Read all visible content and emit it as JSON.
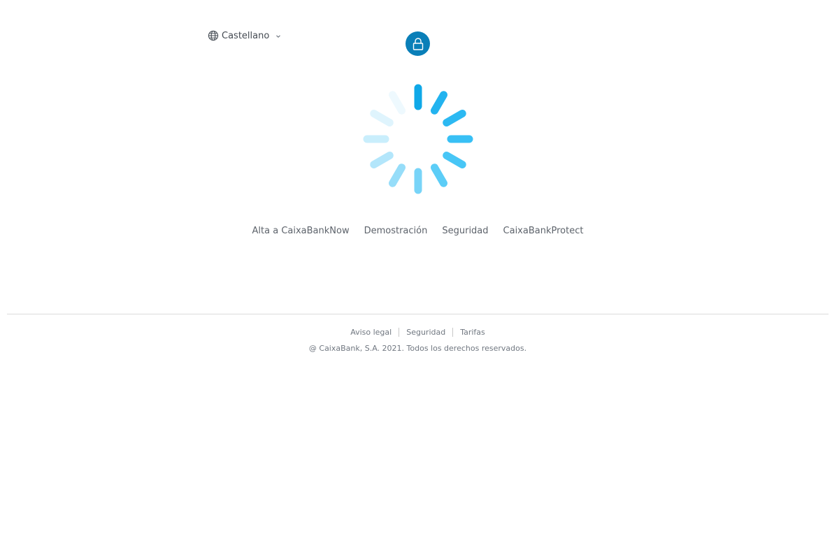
{
  "language": {
    "selected": "Castellano",
    "icon": "globe-icon",
    "chevron_icon": "chevron-down-icon"
  },
  "header": {
    "badge_icon": "lock-icon",
    "badge_color": "#0a7fb8"
  },
  "loader": {
    "icon": "loading-spinner",
    "spoke_colors": [
      "#0fa8e8",
      "#22b3ef",
      "#2cb9f2",
      "#38c0f5",
      "#48c6f6",
      "#5ccdf7",
      "#78d4f8",
      "#96ddf9",
      "#b3e6fb",
      "#c9eefc",
      "#dff4fd",
      "#eef9fe"
    ]
  },
  "links": [
    {
      "label": "Alta a CaixaBankNow"
    },
    {
      "label": "Demostración"
    },
    {
      "label": "Seguridad"
    },
    {
      "label": "CaixaBankProtect"
    }
  ],
  "footer": {
    "links": [
      {
        "label": "Aviso legal"
      },
      {
        "label": "Seguridad"
      },
      {
        "label": "Tarifas"
      }
    ],
    "copyright": "@ CaixaBank, S.A. 2021. Todos los derechos reservados."
  }
}
